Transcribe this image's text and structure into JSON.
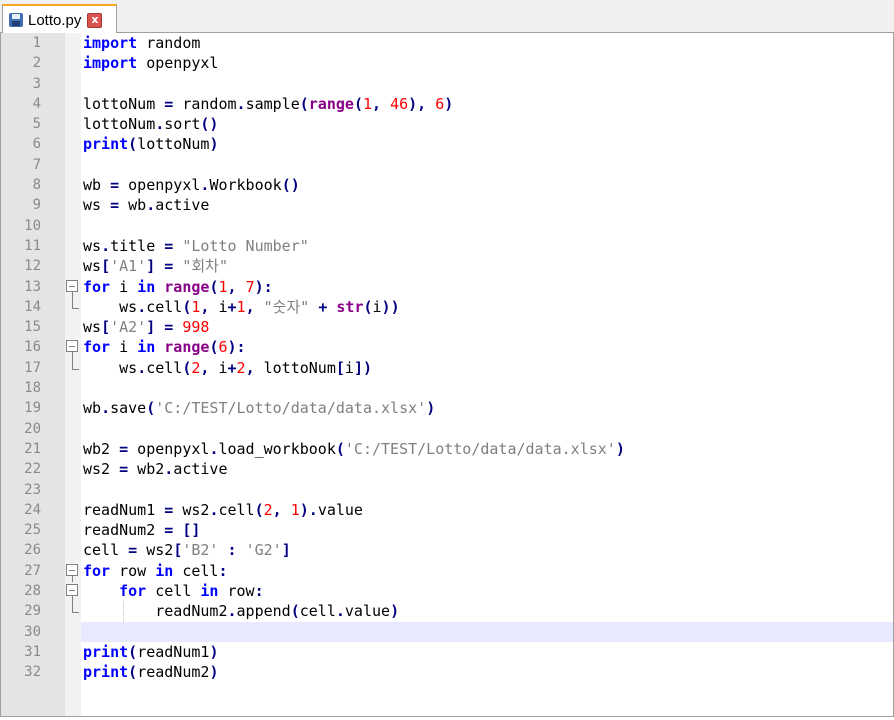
{
  "tab": {
    "title": "Lotto.py",
    "close_glyph": "x",
    "icon": "floppy-save-icon"
  },
  "colors": {
    "keyword": "#0000ff",
    "builtin": "#880088",
    "number": "#ff0000",
    "string": "#808080",
    "operator": "#000080",
    "current_line": "#e8e8ff"
  },
  "editor": {
    "current_line": 30,
    "lines": [
      {
        "num": "1",
        "tokens": [
          [
            "kw",
            "import"
          ],
          [
            "id",
            " random"
          ]
        ]
      },
      {
        "num": "2",
        "tokens": [
          [
            "kw",
            "import"
          ],
          [
            "id",
            " openpyxl"
          ]
        ]
      },
      {
        "num": "3",
        "tokens": []
      },
      {
        "num": "4",
        "tokens": [
          [
            "id",
            "lottoNum "
          ],
          [
            "op",
            "="
          ],
          [
            "id",
            " random"
          ],
          [
            "op",
            "."
          ],
          [
            "id",
            "sample"
          ],
          [
            "op",
            "("
          ],
          [
            "bi",
            "range"
          ],
          [
            "op",
            "("
          ],
          [
            "num",
            "1"
          ],
          [
            "op",
            ","
          ],
          [
            "id",
            " "
          ],
          [
            "num",
            "46"
          ],
          [
            "op",
            ")"
          ],
          [
            "op",
            ","
          ],
          [
            "id",
            " "
          ],
          [
            "num",
            "6"
          ],
          [
            "op",
            ")"
          ]
        ]
      },
      {
        "num": "5",
        "tokens": [
          [
            "id",
            "lottoNum"
          ],
          [
            "op",
            "."
          ],
          [
            "id",
            "sort"
          ],
          [
            "op",
            "()"
          ]
        ]
      },
      {
        "num": "6",
        "tokens": [
          [
            "kw",
            "print"
          ],
          [
            "op",
            "("
          ],
          [
            "id",
            "lottoNum"
          ],
          [
            "op",
            ")"
          ]
        ]
      },
      {
        "num": "7",
        "tokens": []
      },
      {
        "num": "8",
        "tokens": [
          [
            "id",
            "wb "
          ],
          [
            "op",
            "="
          ],
          [
            "id",
            " openpyxl"
          ],
          [
            "op",
            "."
          ],
          [
            "id",
            "Workbook"
          ],
          [
            "op",
            "()"
          ]
        ]
      },
      {
        "num": "9",
        "tokens": [
          [
            "id",
            "ws "
          ],
          [
            "op",
            "="
          ],
          [
            "id",
            " wb"
          ],
          [
            "op",
            "."
          ],
          [
            "id",
            "active"
          ]
        ]
      },
      {
        "num": "10",
        "tokens": []
      },
      {
        "num": "11",
        "tokens": [
          [
            "id",
            "ws"
          ],
          [
            "op",
            "."
          ],
          [
            "id",
            "title "
          ],
          [
            "op",
            "="
          ],
          [
            "id",
            " "
          ],
          [
            "str",
            "\"Lotto Number\""
          ]
        ]
      },
      {
        "num": "12",
        "tokens": [
          [
            "id",
            "ws"
          ],
          [
            "op",
            "["
          ],
          [
            "str",
            "'A1'"
          ],
          [
            "op",
            "]"
          ],
          [
            "id",
            " "
          ],
          [
            "op",
            "="
          ],
          [
            "id",
            " "
          ],
          [
            "str",
            "\"회차\""
          ]
        ]
      },
      {
        "num": "13",
        "fold": "start",
        "tokens": [
          [
            "kw",
            "for"
          ],
          [
            "id",
            " i "
          ],
          [
            "kw",
            "in"
          ],
          [
            "id",
            " "
          ],
          [
            "bi",
            "range"
          ],
          [
            "op",
            "("
          ],
          [
            "num",
            "1"
          ],
          [
            "op",
            ","
          ],
          [
            "id",
            " "
          ],
          [
            "num",
            "7"
          ],
          [
            "op",
            "):"
          ]
        ]
      },
      {
        "num": "14",
        "fold": "end",
        "tokens": [
          [
            "id",
            "    ws"
          ],
          [
            "op",
            "."
          ],
          [
            "id",
            "cell"
          ],
          [
            "op",
            "("
          ],
          [
            "num",
            "1"
          ],
          [
            "op",
            ","
          ],
          [
            "id",
            " i"
          ],
          [
            "op",
            "+"
          ],
          [
            "num",
            "1"
          ],
          [
            "op",
            ","
          ],
          [
            "id",
            " "
          ],
          [
            "str",
            "\"숫자\""
          ],
          [
            "id",
            " "
          ],
          [
            "op",
            "+"
          ],
          [
            "id",
            " "
          ],
          [
            "bi",
            "str"
          ],
          [
            "op",
            "("
          ],
          [
            "id",
            "i"
          ],
          [
            "op",
            "))"
          ]
        ]
      },
      {
        "num": "15",
        "tokens": [
          [
            "id",
            "ws"
          ],
          [
            "op",
            "["
          ],
          [
            "str",
            "'A2'"
          ],
          [
            "op",
            "]"
          ],
          [
            "id",
            " "
          ],
          [
            "op",
            "="
          ],
          [
            "id",
            " "
          ],
          [
            "num",
            "998"
          ]
        ]
      },
      {
        "num": "16",
        "fold": "start",
        "tokens": [
          [
            "kw",
            "for"
          ],
          [
            "id",
            " i "
          ],
          [
            "kw",
            "in"
          ],
          [
            "id",
            " "
          ],
          [
            "bi",
            "range"
          ],
          [
            "op",
            "("
          ],
          [
            "num",
            "6"
          ],
          [
            "op",
            "):"
          ]
        ]
      },
      {
        "num": "17",
        "fold": "end",
        "tokens": [
          [
            "id",
            "    ws"
          ],
          [
            "op",
            "."
          ],
          [
            "id",
            "cell"
          ],
          [
            "op",
            "("
          ],
          [
            "num",
            "2"
          ],
          [
            "op",
            ","
          ],
          [
            "id",
            " i"
          ],
          [
            "op",
            "+"
          ],
          [
            "num",
            "2"
          ],
          [
            "op",
            ","
          ],
          [
            "id",
            " lottoNum"
          ],
          [
            "op",
            "["
          ],
          [
            "id",
            "i"
          ],
          [
            "op",
            "])"
          ]
        ]
      },
      {
        "num": "18",
        "tokens": []
      },
      {
        "num": "19",
        "tokens": [
          [
            "id",
            "wb"
          ],
          [
            "op",
            "."
          ],
          [
            "id",
            "save"
          ],
          [
            "op",
            "("
          ],
          [
            "str",
            "'C:/TEST/Lotto/data/data.xlsx'"
          ],
          [
            "op",
            ")"
          ]
        ]
      },
      {
        "num": "20",
        "tokens": []
      },
      {
        "num": "21",
        "tokens": [
          [
            "id",
            "wb2 "
          ],
          [
            "op",
            "="
          ],
          [
            "id",
            " openpyxl"
          ],
          [
            "op",
            "."
          ],
          [
            "id",
            "load_workbook"
          ],
          [
            "op",
            "("
          ],
          [
            "str",
            "'C:/TEST/Lotto/data/data.xlsx'"
          ],
          [
            "op",
            ")"
          ]
        ]
      },
      {
        "num": "22",
        "tokens": [
          [
            "id",
            "ws2 "
          ],
          [
            "op",
            "="
          ],
          [
            "id",
            " wb2"
          ],
          [
            "op",
            "."
          ],
          [
            "id",
            "active"
          ]
        ]
      },
      {
        "num": "23",
        "tokens": []
      },
      {
        "num": "24",
        "tokens": [
          [
            "id",
            "readNum1 "
          ],
          [
            "op",
            "="
          ],
          [
            "id",
            " ws2"
          ],
          [
            "op",
            "."
          ],
          [
            "id",
            "cell"
          ],
          [
            "op",
            "("
          ],
          [
            "num",
            "2"
          ],
          [
            "op",
            ","
          ],
          [
            "id",
            " "
          ],
          [
            "num",
            "1"
          ],
          [
            "op",
            ")."
          ],
          [
            "id",
            "value"
          ]
        ]
      },
      {
        "num": "25",
        "tokens": [
          [
            "id",
            "readNum2 "
          ],
          [
            "op",
            "="
          ],
          [
            "id",
            " "
          ],
          [
            "op",
            "[]"
          ]
        ]
      },
      {
        "num": "26",
        "tokens": [
          [
            "id",
            "cell "
          ],
          [
            "op",
            "="
          ],
          [
            "id",
            " ws2"
          ],
          [
            "op",
            "["
          ],
          [
            "str",
            "'B2'"
          ],
          [
            "id",
            " "
          ],
          [
            "op",
            ":"
          ],
          [
            "id",
            " "
          ],
          [
            "str",
            "'G2'"
          ],
          [
            "op",
            "]"
          ]
        ]
      },
      {
        "num": "27",
        "fold": "start",
        "tokens": [
          [
            "kw",
            "for"
          ],
          [
            "id",
            " row "
          ],
          [
            "kw",
            "in"
          ],
          [
            "id",
            " cell"
          ],
          [
            "op",
            ":"
          ]
        ]
      },
      {
        "num": "28",
        "fold": "start",
        "tokens": [
          [
            "id",
            "    "
          ],
          [
            "kw",
            "for"
          ],
          [
            "id",
            " cell "
          ],
          [
            "kw",
            "in"
          ],
          [
            "id",
            " row"
          ],
          [
            "op",
            ":"
          ]
        ]
      },
      {
        "num": "29",
        "fold": "end",
        "guides": [
          4
        ],
        "tokens": [
          [
            "id",
            "        readNum2"
          ],
          [
            "op",
            "."
          ],
          [
            "id",
            "append"
          ],
          [
            "op",
            "("
          ],
          [
            "id",
            "cell"
          ],
          [
            "op",
            "."
          ],
          [
            "id",
            "value"
          ],
          [
            "op",
            ")"
          ]
        ]
      },
      {
        "num": "30",
        "tokens": []
      },
      {
        "num": "31",
        "tokens": [
          [
            "kw",
            "print"
          ],
          [
            "op",
            "("
          ],
          [
            "id",
            "readNum1"
          ],
          [
            "op",
            ")"
          ]
        ]
      },
      {
        "num": "32",
        "tokens": [
          [
            "kw",
            "print"
          ],
          [
            "op",
            "("
          ],
          [
            "id",
            "readNum2"
          ],
          [
            "op",
            ")"
          ]
        ]
      }
    ]
  }
}
